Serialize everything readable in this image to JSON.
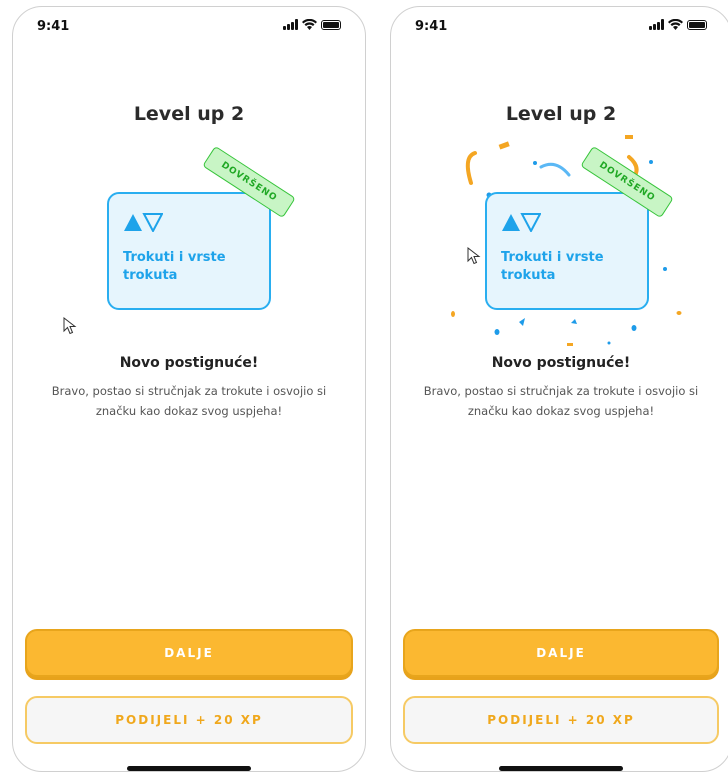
{
  "screens": [
    {
      "status": {
        "time": "9:41"
      },
      "title": "Level up 2",
      "badge": {
        "label": "Trokuti i vrste trokuta",
        "stamp": "DOVRŠENO"
      },
      "achievement": {
        "title": "Novo postignuće!",
        "description": "Bravo, postao si stručnjak za trokute i osvojio si značku kao dokaz svog uspjeha!"
      },
      "buttons": {
        "next": "DALJE",
        "share": "PODIJELI + 20 XP"
      }
    },
    {
      "status": {
        "time": "9:41"
      },
      "title": "Level up 2",
      "badge": {
        "label": "Trokuti i vrste trokuta",
        "stamp": "DOVRŠENO"
      },
      "achievement": {
        "title": "Novo postignuće!",
        "description": "Bravo, postao si stručnjak za trokute i osvojio si značku kao dokaz svog uspjeha!"
      },
      "buttons": {
        "next": "DALJE",
        "share": "PODIJELI + 20 XP"
      }
    }
  ],
  "icons": {
    "signal": "signal-icon",
    "wifi": "wifi-icon",
    "battery": "battery-icon",
    "badge": "triangles-icon",
    "cursor": "cursor-icon"
  },
  "colors": {
    "accent": "#fbb831",
    "badge_blue": "#29aef0",
    "stamp_green": "#37c43b"
  }
}
